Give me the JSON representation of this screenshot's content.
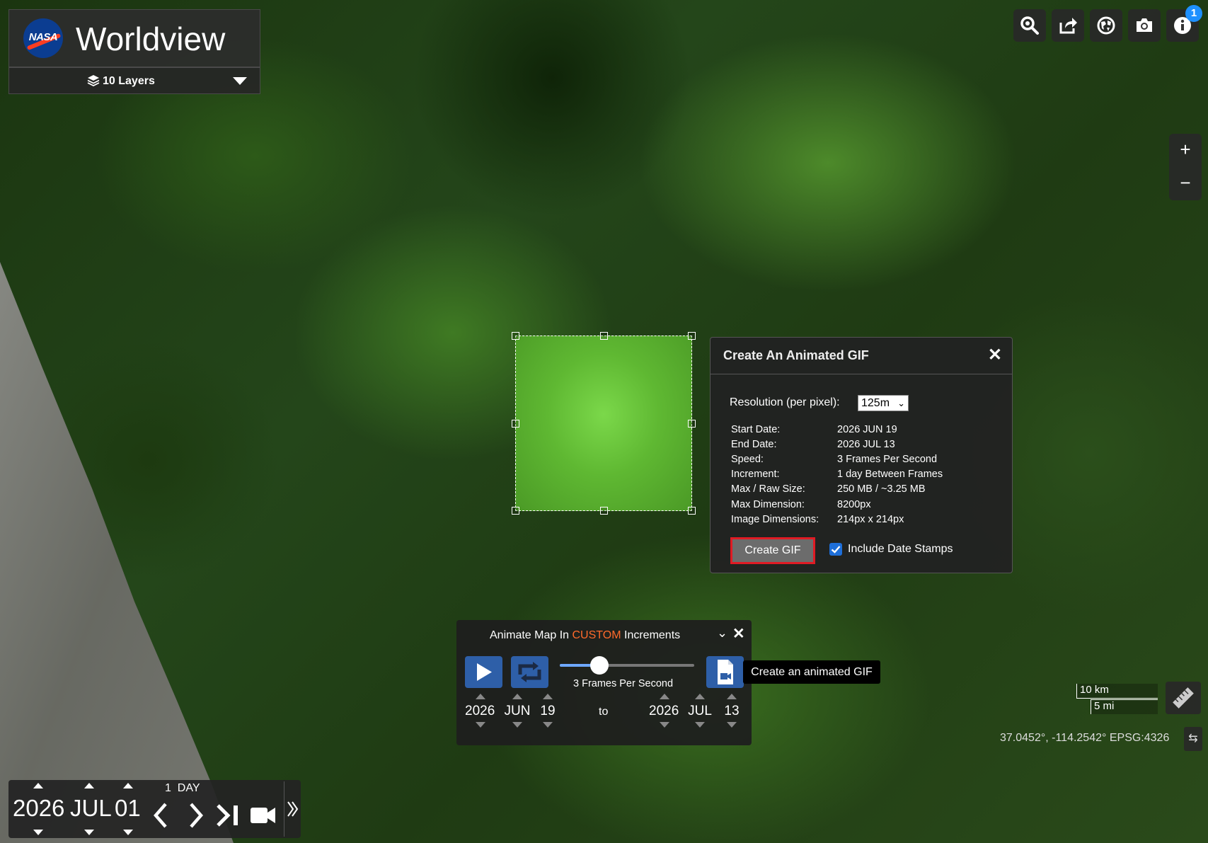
{
  "app": {
    "title": "Worldview"
  },
  "layers": {
    "label": "10 Layers"
  },
  "toolbar": {
    "badge": "1",
    "icons": [
      "search-icon",
      "share-icon",
      "projection-icon",
      "camera-icon",
      "info-icon"
    ]
  },
  "zoom": {
    "plus": "+",
    "minus": "−"
  },
  "gif_dialog": {
    "title": "Create An Animated GIF",
    "close": "✕",
    "resolution_label": "Resolution (per pixel):",
    "resolution_value": "125m",
    "rows": [
      {
        "k": "Start Date:",
        "v": "2026  JUN  19"
      },
      {
        "k": "End Date:",
        "v": "2026  JUL  13"
      },
      {
        "k": "Speed:",
        "v": "3 Frames Per Second"
      },
      {
        "k": "Increment:",
        "v": "1 day Between Frames"
      },
      {
        "k": "Max / Raw Size:",
        "v": "250 MB / ~3.25 MB"
      },
      {
        "k": "Max Dimension:",
        "v": "8200px"
      },
      {
        "k": "Image Dimensions:",
        "v": "214px x 214px"
      }
    ],
    "create_button": "Create GIF",
    "include_dates_label": "Include Date Stamps",
    "include_dates_checked": true,
    "accent_color": "#e01b24"
  },
  "animation": {
    "title_prefix": "Animate Map In ",
    "title_mode": "CUSTOM",
    "title_suffix": " Increments",
    "fps_label": "3 Frames Per Second",
    "fps_value": 3,
    "start": {
      "year": "2026",
      "month": "JUN",
      "day": "19"
    },
    "to_label": "to",
    "end": {
      "year": "2026",
      "month": "JUL",
      "day": "13"
    },
    "tooltip": "Create an animated GIF",
    "accent_color": "#2e5fa8"
  },
  "scale": {
    "km": "10 km",
    "mi": "5 mi"
  },
  "coords": {
    "text": "37.0452°, -114.2542°  EPSG:4326"
  },
  "timeline": {
    "year": "2026",
    "month": "JUL",
    "day": "01",
    "increment_value": "1",
    "increment_unit": "DAY"
  }
}
